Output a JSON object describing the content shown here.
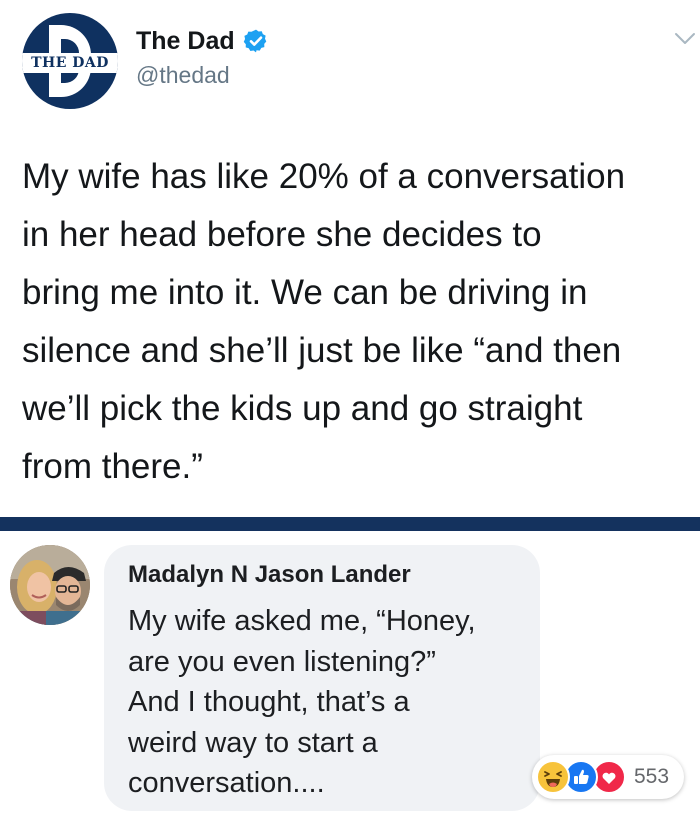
{
  "tweet": {
    "author_name": "The Dad",
    "handle": "@thedad",
    "avatar_logo_text": "THE DAD",
    "text_lines": [
      "My wife has like 20% of a conversation",
      "in her head before she decides to",
      "bring me into it. We can be driving in",
      "silence and she’ll just be like “and then",
      "we’ll pick the kids up and go straight",
      "from there.”"
    ],
    "icons": {
      "verified": "verified-badge-icon",
      "menu": "chevron-down-icon"
    },
    "colors": {
      "verified": "#1da1f2",
      "brand_navy": "#0f3160",
      "handle": "#657786"
    }
  },
  "comment": {
    "author_name": "Madalyn N Jason Lander",
    "text_lines": [
      "My wife asked me, “Honey,",
      "are you even listening?”",
      "And I thought, that’s a",
      "weird way to start a",
      "conversation...."
    ],
    "reactions": {
      "types": [
        "haha",
        "like",
        "love"
      ],
      "count": "553"
    },
    "colors": {
      "bubble": "#f0f2f5",
      "like": "#1877f2",
      "love": "#f02849",
      "haha": "#f7c33b"
    }
  }
}
